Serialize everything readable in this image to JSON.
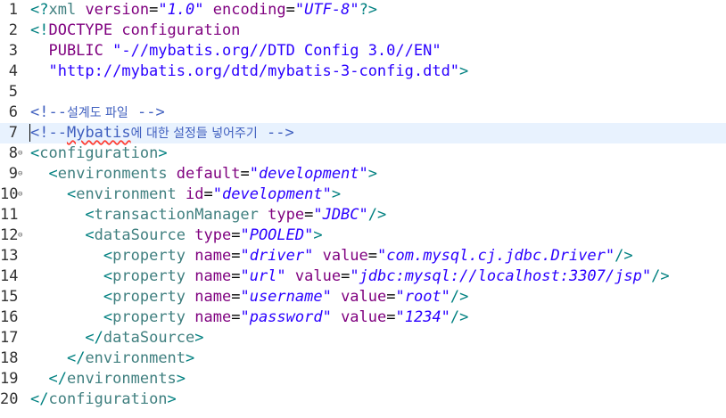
{
  "editor": {
    "current_line": 7,
    "lines": [
      {
        "n": "1",
        "fold": "",
        "segs": [
          [
            "b",
            "<?"
          ],
          [
            "t",
            "xml "
          ],
          [
            "a",
            "version"
          ],
          [
            "e",
            "="
          ],
          [
            "v",
            "\"1.0\""
          ],
          [
            "a",
            " encoding"
          ],
          [
            "e",
            "="
          ],
          [
            "v",
            "\"UTF-8\""
          ],
          [
            "b",
            "?>"
          ]
        ]
      },
      {
        "n": "2",
        "fold": "",
        "segs": [
          [
            "b",
            "<!"
          ],
          [
            "x",
            "DOCTYPE configuration"
          ]
        ]
      },
      {
        "n": "3",
        "fold": "",
        "segs": [
          [
            "x",
            "  PUBLIC "
          ],
          [
            "s",
            "\"-//mybatis.org//DTD Config 3.0//EN\""
          ]
        ]
      },
      {
        "n": "4",
        "fold": "",
        "segs": [
          [
            "s",
            "  \"http://mybatis.org/dtd/mybatis-3-config.dtd\""
          ],
          [
            "b",
            ">"
          ]
        ]
      },
      {
        "n": "5",
        "fold": "",
        "segs": []
      },
      {
        "n": "6",
        "fold": "",
        "segs": [
          [
            "c",
            "<!--"
          ],
          [
            "ck",
            "설계도 파일"
          ],
          [
            "c",
            " -->"
          ]
        ]
      },
      {
        "n": "7",
        "fold": "",
        "segs": [
          [
            "cc",
            "<"
          ],
          [
            "c",
            "!--"
          ],
          [
            "csq",
            "Mybatis"
          ],
          [
            "ck",
            "에 대한 설정들 넣어주기"
          ],
          [
            "c",
            " -->"
          ]
        ]
      },
      {
        "n": "8",
        "fold": "⊖",
        "segs": [
          [
            "b",
            "<"
          ],
          [
            "t",
            "configuration"
          ],
          [
            "b",
            ">"
          ]
        ]
      },
      {
        "n": "9",
        "fold": "⊖",
        "segs": [
          [
            "e",
            "  "
          ],
          [
            "b",
            "<"
          ],
          [
            "t",
            "environments "
          ],
          [
            "a",
            "default"
          ],
          [
            "e",
            "="
          ],
          [
            "v",
            "\"development\""
          ],
          [
            "b",
            ">"
          ]
        ]
      },
      {
        "n": "10",
        "fold": "⊖",
        "segs": [
          [
            "e",
            "    "
          ],
          [
            "b",
            "<"
          ],
          [
            "t",
            "environment "
          ],
          [
            "a",
            "id"
          ],
          [
            "e",
            "="
          ],
          [
            "v",
            "\"development\""
          ],
          [
            "b",
            ">"
          ]
        ]
      },
      {
        "n": "11",
        "fold": "",
        "segs": [
          [
            "e",
            "      "
          ],
          [
            "b",
            "<"
          ],
          [
            "t",
            "transactionManager "
          ],
          [
            "a",
            "type"
          ],
          [
            "e",
            "="
          ],
          [
            "v",
            "\"JDBC\""
          ],
          [
            "b",
            "/>"
          ]
        ]
      },
      {
        "n": "12",
        "fold": "⊖",
        "segs": [
          [
            "e",
            "      "
          ],
          [
            "b",
            "<"
          ],
          [
            "t",
            "dataSource "
          ],
          [
            "a",
            "type"
          ],
          [
            "e",
            "="
          ],
          [
            "v",
            "\"POOLED\""
          ],
          [
            "b",
            ">"
          ]
        ]
      },
      {
        "n": "13",
        "fold": "",
        "segs": [
          [
            "e",
            "        "
          ],
          [
            "b",
            "<"
          ],
          [
            "t",
            "property "
          ],
          [
            "a",
            "name"
          ],
          [
            "e",
            "="
          ],
          [
            "v",
            "\"driver\""
          ],
          [
            "a",
            " value"
          ],
          [
            "e",
            "="
          ],
          [
            "v",
            "\"com.mysql.cj.jdbc.Driver\""
          ],
          [
            "b",
            "/>"
          ]
        ]
      },
      {
        "n": "14",
        "fold": "",
        "segs": [
          [
            "e",
            "        "
          ],
          [
            "b",
            "<"
          ],
          [
            "t",
            "property "
          ],
          [
            "a",
            "name"
          ],
          [
            "e",
            "="
          ],
          [
            "v",
            "\"url\""
          ],
          [
            "a",
            " value"
          ],
          [
            "e",
            "="
          ],
          [
            "v",
            "\"jdbc:mysql://localhost:3307/jsp\""
          ],
          [
            "b",
            "/>"
          ]
        ]
      },
      {
        "n": "15",
        "fold": "",
        "segs": [
          [
            "e",
            "        "
          ],
          [
            "b",
            "<"
          ],
          [
            "t",
            "property "
          ],
          [
            "a",
            "name"
          ],
          [
            "e",
            "="
          ],
          [
            "v",
            "\"username\""
          ],
          [
            "a",
            " value"
          ],
          [
            "e",
            "="
          ],
          [
            "v",
            "\"root\""
          ],
          [
            "b",
            "/>"
          ]
        ]
      },
      {
        "n": "16",
        "fold": "",
        "segs": [
          [
            "e",
            "        "
          ],
          [
            "b",
            "<"
          ],
          [
            "t",
            "property "
          ],
          [
            "a",
            "name"
          ],
          [
            "e",
            "="
          ],
          [
            "v",
            "\"password\""
          ],
          [
            "a",
            " value"
          ],
          [
            "e",
            "="
          ],
          [
            "v",
            "\"1234\""
          ],
          [
            "b",
            "/>"
          ]
        ]
      },
      {
        "n": "17",
        "fold": "",
        "segs": [
          [
            "e",
            "      "
          ],
          [
            "b",
            "</"
          ],
          [
            "t",
            "dataSource"
          ],
          [
            "b",
            ">"
          ]
        ]
      },
      {
        "n": "18",
        "fold": "",
        "segs": [
          [
            "e",
            "    "
          ],
          [
            "b",
            "</"
          ],
          [
            "t",
            "environment"
          ],
          [
            "b",
            ">"
          ]
        ]
      },
      {
        "n": "19",
        "fold": "",
        "segs": [
          [
            "e",
            "  "
          ],
          [
            "b",
            "</"
          ],
          [
            "t",
            "environments"
          ],
          [
            "b",
            ">"
          ]
        ]
      },
      {
        "n": "20",
        "fold": "",
        "segs": [
          [
            "b",
            "</"
          ],
          [
            "t",
            "configuration"
          ],
          [
            "b",
            ">"
          ]
        ]
      }
    ]
  }
}
